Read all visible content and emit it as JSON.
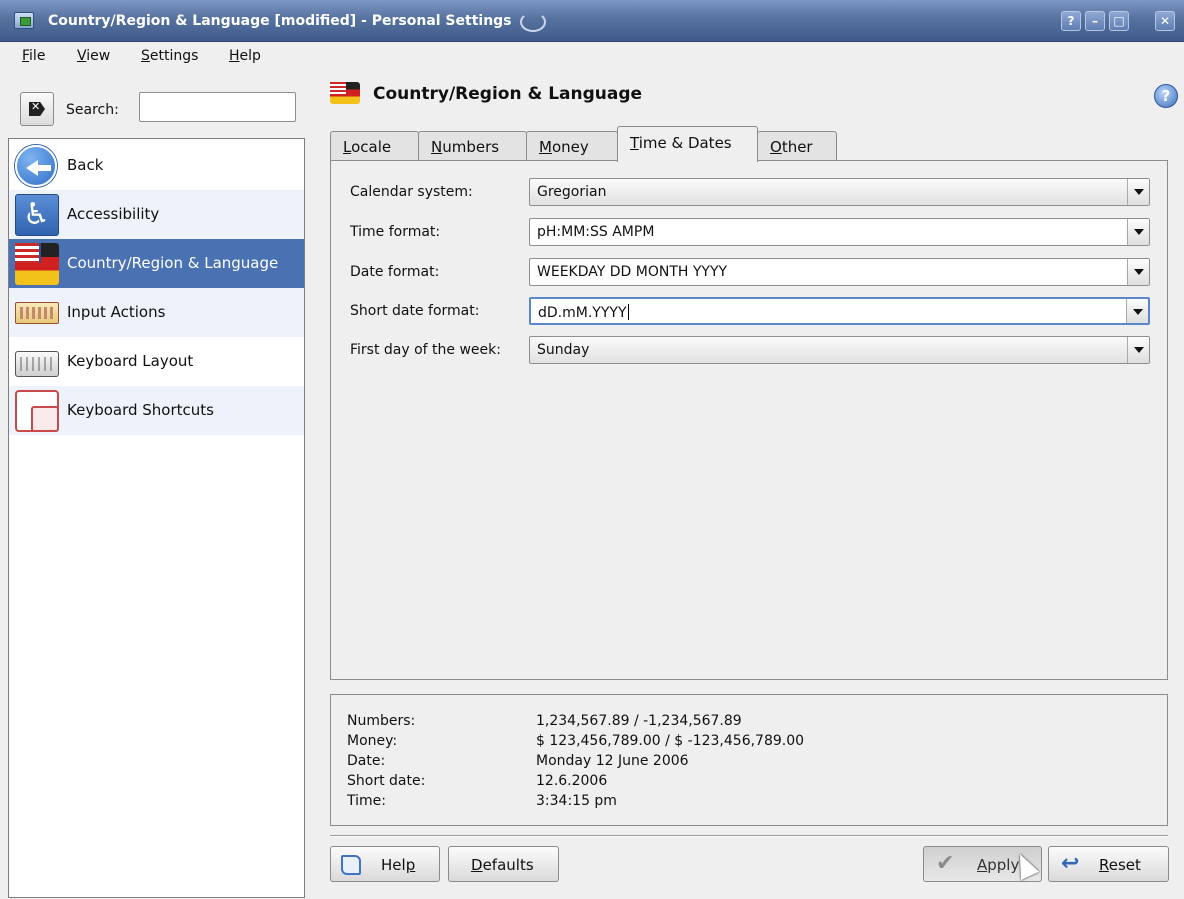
{
  "window": {
    "title": "Country/Region & Language [modified] - Personal Settings",
    "buttons": [
      "?",
      "–",
      "□",
      "✕"
    ]
  },
  "menu": {
    "items": [
      {
        "label": "File",
        "mnemonic": "F"
      },
      {
        "label": "View",
        "mnemonic": "V"
      },
      {
        "label": "Settings",
        "mnemonic": "S"
      },
      {
        "label": "Help",
        "mnemonic": "H"
      }
    ]
  },
  "search": {
    "label": "Search:",
    "value": ""
  },
  "sidebar": {
    "items": [
      {
        "label": "Back",
        "icon": "back-arrow-icon"
      },
      {
        "label": "Accessibility",
        "icon": "accessibility-icon"
      },
      {
        "label": "Country/Region & Language",
        "icon": "flag-icon",
        "selected": true
      },
      {
        "label": "Input Actions",
        "icon": "input-actions-icon"
      },
      {
        "label": "Keyboard Layout",
        "icon": "keyboard-icon"
      },
      {
        "label": "Keyboard Shortcuts",
        "icon": "keyboard-shortcuts-icon"
      }
    ]
  },
  "panel": {
    "title": "Country/Region & Language"
  },
  "tabs": [
    {
      "label": "Locale",
      "active": false
    },
    {
      "label": "Numbers",
      "active": false
    },
    {
      "label": "Money",
      "active": false
    },
    {
      "label": "Time & Dates",
      "active": true
    },
    {
      "label": "Other",
      "active": false
    }
  ],
  "form": {
    "calendar_system": {
      "label": "Calendar system:",
      "value": "Gregorian"
    },
    "time_format": {
      "label": "Time format:",
      "value": "pH:MM:SS AMPM"
    },
    "date_format": {
      "label": "Date format:",
      "value": "WEEKDAY DD MONTH YYYY"
    },
    "short_date_format": {
      "label": "Short date format:",
      "value": "dD.mM.YYYY"
    },
    "first_day": {
      "label": "First day of the week:",
      "value": "Sunday"
    }
  },
  "summary": {
    "numbers": {
      "label": "Numbers:",
      "value": "1,234,567.89 / -1,234,567.89"
    },
    "money": {
      "label": "Money:",
      "value": "$ 123,456,789.00 / $ -123,456,789.00"
    },
    "date": {
      "label": "Date:",
      "value": "Monday 12 June 2006"
    },
    "short_date": {
      "label": "Short date:",
      "value": "12.6.2006"
    },
    "time": {
      "label": "Time:",
      "value": "3:34:15 pm"
    }
  },
  "buttons": {
    "help": "Help",
    "defaults": "Defaults",
    "apply": "Apply",
    "reset": "Reset"
  },
  "colors": {
    "selection": "#4a72b3",
    "titlebar": "#56729f"
  }
}
